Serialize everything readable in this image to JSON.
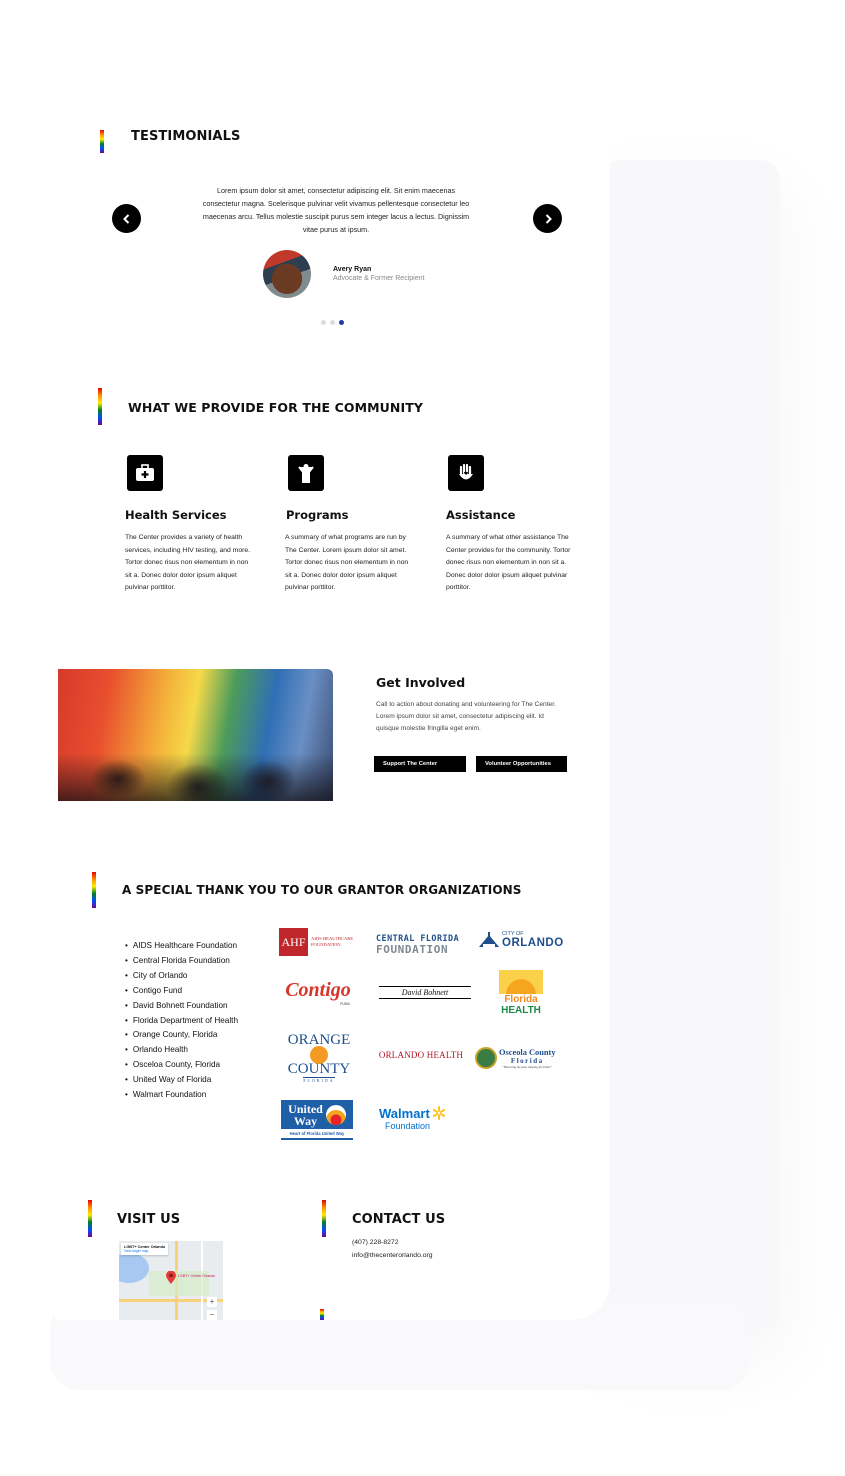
{
  "testimonials": {
    "heading": "TESTIMONIALS",
    "quote": "Lorem ipsum dolor sit amet, consectetur adipiscing elit. Sit enim maecenas consectetur magna. Scelerisque pulvinar velit vivamus pellentesque consectetur leo maecenas arcu. Tellus molestie suscipit purus sem integer lacus a lectus. Dignissim vitae purus at ipsum.",
    "author_name": "Avery Ryan",
    "author_role": "Advocate & Former Recipient",
    "prev_icon": "chevron-left-icon",
    "next_icon": "chevron-right-icon",
    "slides": 3,
    "active_slide": 3
  },
  "provide": {
    "heading": "WHAT WE PROVIDE FOR THE COMMUNITY",
    "services": [
      {
        "icon": "medical-kit-icon",
        "title": "Health Services",
        "description": "The Center provides a variety of health services, including HIV testing, and more. Tortor donec risus non elementum in non sit a. Donec dolor dolor ipsum aliquet pulvinar porttitor."
      },
      {
        "icon": "person-icon",
        "title": "Programs",
        "description": "A summary of what programs are run by The Center. Lorem ipsum dolor sit amet. Tortor donec risus non elementum in non sit a. Donec dolor dolor ipsum aliquet pulvinar porttitor."
      },
      {
        "icon": "helping-hand-icon",
        "title": "Assistance",
        "description": "A summary of what other assistance The Center provides for the community. Tortor donec risus non elementum in non sit a. Donec dolor dolor ipsum aliquet pulvinar porttitor."
      }
    ]
  },
  "involved": {
    "heading": "Get Involved",
    "text": "Call to action about donating and volunteering for The Center. Lorem ipsum dolor sit amet, consectetur adipiscing elit. Id quisque molestie fringilla eget enim.",
    "support_label": "Support The Center",
    "volunteer_label": "Volunteer Opportunities"
  },
  "grantors": {
    "heading": "A SPECIAL THANK YOU TO OUR GRANTOR ORGANIZATIONS",
    "list": [
      "AIDS Healthcare Foundation",
      "Central Florida Foundation",
      "City of Orlando",
      "Contigo Fund",
      "David Bohnett Foundation",
      "Florida Department of Health",
      "Orange County, Florida",
      "Orlando Health",
      "Osceloa County, Florida",
      "United Way of Florida",
      "Walmart Foundation"
    ],
    "logos": {
      "ahf_mark": "AHF",
      "ahf_sub1": "AIDS HEALTHCARE",
      "ahf_sub2": "FOUNDATION",
      "cff1": "CENTRAL FLORIDA",
      "cff2": "FOUNDATION",
      "orl_small": "CITY OF",
      "orl_big": "ORLANDO",
      "contigo": "Contigo",
      "contigo_sub": "FUND",
      "bohnett": "David Bohnett",
      "fl_health1": "Florida",
      "fl_health2": "HEALTH",
      "orange1": "ORANGE",
      "orange2": "COUNTY",
      "orange3": "FLORIDA",
      "orlando_health": "ORLANDO HEALTH",
      "osceola1": "Osceola County",
      "osceola2": "Florida",
      "osceola3": "\"Honoring the past shaping the future\"",
      "uw1": "United",
      "uw2": "Way",
      "uw3": "Heart of Florida United Way",
      "walmart1": "Walmart",
      "walmart2": "Foundation"
    }
  },
  "visit": {
    "heading": "VISIT US",
    "map_label": "LGBT+ Center Orlando",
    "map_link": "View larger map",
    "map_pin_label": "LGBT+ Center Orlando"
  },
  "contact": {
    "heading": "CONTACT US",
    "phone": "(407) 228-8272",
    "email": "info@thecenterorlando.org"
  },
  "colors": {
    "accent_blue": "#1d3aa8",
    "button_bg": "#000000",
    "ahf_red": "#c0272d",
    "cff_blue": "#1f4e8c",
    "walmart_blue": "#0071ce",
    "walmart_yellow": "#ffc220"
  }
}
